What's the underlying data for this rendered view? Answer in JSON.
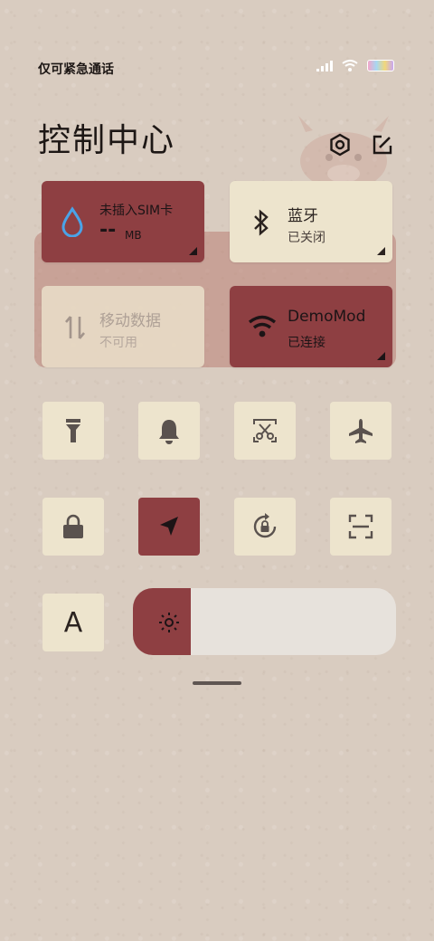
{
  "status_bar": {
    "text": "仅可紧急通话",
    "signal_icon": "signal-icon",
    "wifi_icon": "wifi-icon",
    "battery_icon": "battery-icon"
  },
  "header": {
    "title": "控制中心",
    "settings_icon": "settings-icon",
    "edit_icon": "edit-icon"
  },
  "tiles": {
    "data_usage": {
      "label": "未插入SIM卡",
      "value": "--",
      "unit": "MB",
      "icon": "water-drop-icon"
    },
    "bluetooth": {
      "label": "蓝牙",
      "status": "已关闭",
      "icon": "bluetooth-icon"
    },
    "mobile_data": {
      "label": "移动数据",
      "status": "不可用",
      "icon": "mobile-data-icon"
    },
    "wifi": {
      "label": "DemoMod",
      "status": "已连接",
      "icon": "wifi-icon"
    }
  },
  "toggles": [
    {
      "name": "flashlight",
      "icon": "flashlight-icon",
      "active": false
    },
    {
      "name": "sound",
      "icon": "bell-icon",
      "active": false
    },
    {
      "name": "screenshot",
      "icon": "scissors-icon",
      "active": false
    },
    {
      "name": "airplane",
      "icon": "airplane-icon",
      "active": false
    },
    {
      "name": "lock",
      "icon": "lock-icon",
      "active": false
    },
    {
      "name": "location",
      "icon": "location-icon",
      "active": true
    },
    {
      "name": "rotation-lock",
      "icon": "rotate-lock-icon",
      "active": false
    },
    {
      "name": "scanner",
      "icon": "scan-icon",
      "active": false
    },
    {
      "name": "font",
      "icon": "font-icon",
      "active": false,
      "text": "A"
    }
  ],
  "brightness": {
    "level": 0.22,
    "icon": "sun-icon"
  },
  "colors": {
    "accent": "#8e3f42",
    "tile": "#ede4cd",
    "background": "#d9ccc0"
  }
}
